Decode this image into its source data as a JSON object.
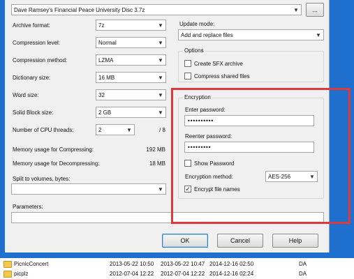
{
  "archive": {
    "path": "Dave Ramsey's Financial Peace University Disc 3.7z",
    "browse_label": "..."
  },
  "left": {
    "archive_format": {
      "label": "Archive format:",
      "value": "7z"
    },
    "compression_level": {
      "label": "Compression level:",
      "value": "Normal"
    },
    "compression_method": {
      "label": "Compression method:",
      "value": "LZMA"
    },
    "dictionary_size": {
      "label": "Dictionary size:",
      "value": "16 MB"
    },
    "word_size": {
      "label": "Word size:",
      "value": "32"
    },
    "solid_block_size": {
      "label": "Solid Block size:",
      "value": "2 GB"
    },
    "cpu_threads": {
      "label": "Number of CPU threads:",
      "value": "2",
      "max": "/ 8"
    },
    "memory_compress": {
      "label": "Memory usage for Compressing:",
      "value": "192 MB"
    },
    "memory_decompress": {
      "label": "Memory usage for Decompressing:",
      "value": "18 MB"
    },
    "split": {
      "label": "Split to volumes, bytes:",
      "value": ""
    },
    "parameters": {
      "label": "Parameters:",
      "value": ""
    }
  },
  "right": {
    "update_mode": {
      "label": "Update mode:",
      "value": "Add and replace files"
    },
    "options": {
      "title": "Options",
      "create_sfx": {
        "label": "Create SFX archive",
        "checked": false
      },
      "compress_shared": {
        "label": "Compress shared files",
        "checked": false
      }
    },
    "encryption": {
      "title": "Encryption",
      "enter_password_label": "Enter password:",
      "enter_password_value": "••••••••••",
      "reenter_password_label": "Reenter password:",
      "reenter_password_value": "•••••••••",
      "show_password": {
        "label": "Show Password",
        "checked": false
      },
      "method_label": "Encryption method:",
      "method_value": "AES-256",
      "encrypt_names": {
        "label": "Encrypt file names",
        "checked": true,
        "mark": "✓"
      }
    }
  },
  "buttons": {
    "ok": "OK",
    "cancel": "Cancel",
    "help": "Help"
  },
  "files": [
    {
      "name": "PicnicConcert",
      "modified": "2013-05-22 10:50",
      "created": "2013-05-22 10:47",
      "accessed": "2014-12-16 02:50",
      "attr": "DA"
    },
    {
      "name": "picplz",
      "modified": "2012-07-04 12:22",
      "created": "2012-07-04 12:22",
      "accessed": "2014-12-16 02:24",
      "attr": "DA"
    }
  ],
  "colors": {
    "highlight": "#e1393b",
    "frame": "#1f6fcf"
  }
}
